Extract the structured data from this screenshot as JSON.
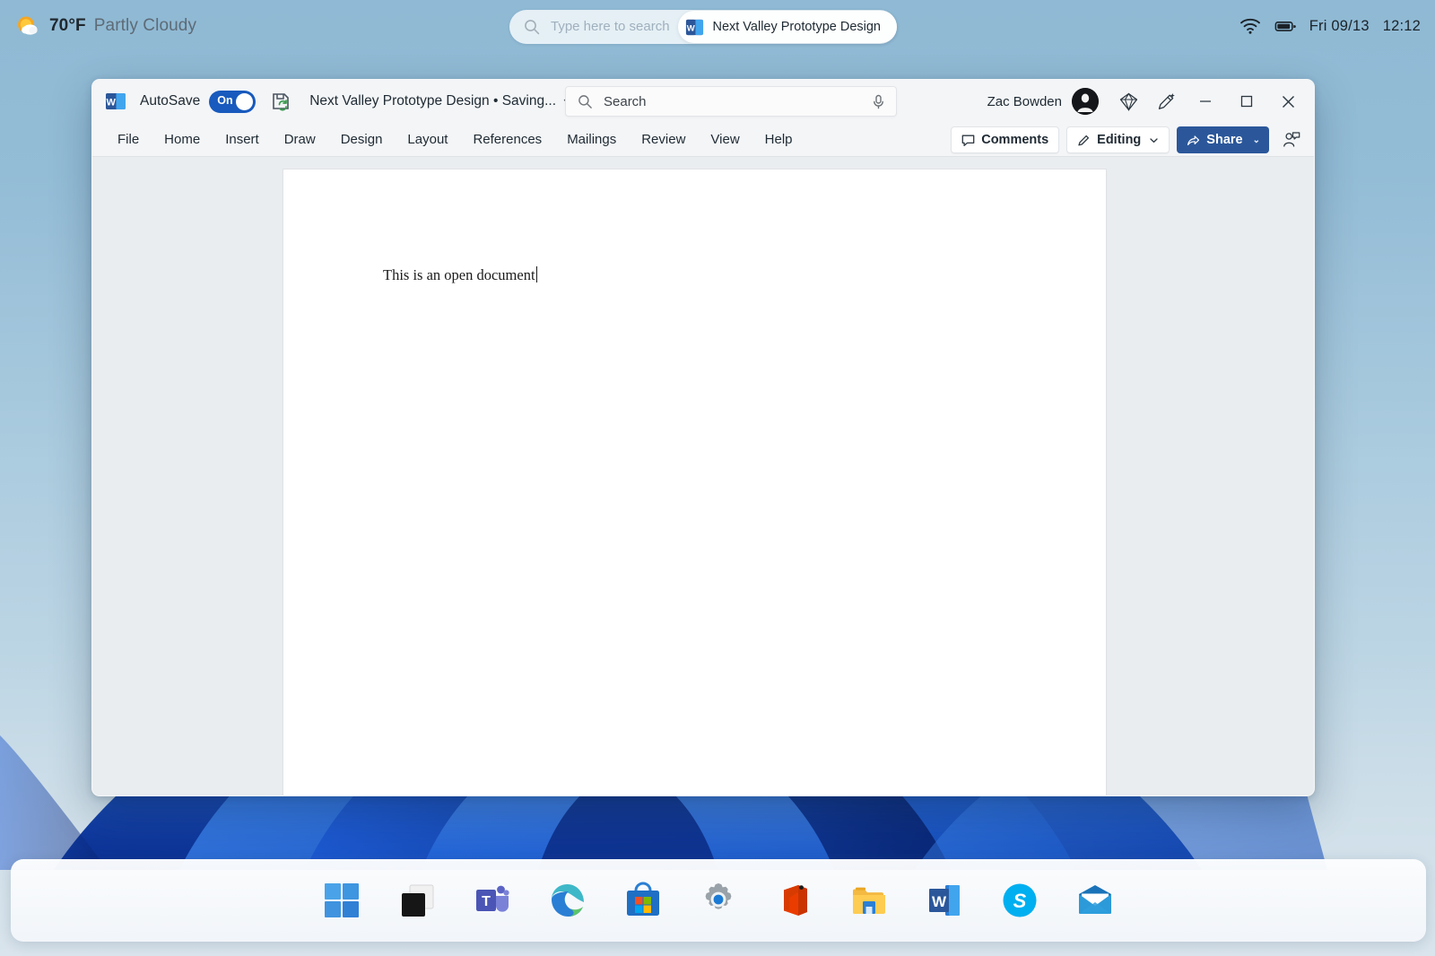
{
  "desktop": {
    "weather": {
      "icon": "partly-cloudy-icon",
      "temperature": "70°F",
      "condition": "Partly Cloudy"
    },
    "taskbar_search": {
      "icon": "search-icon",
      "placeholder": "Type here to search"
    },
    "active_task": {
      "icon": "word-icon",
      "label": "Next Valley Prototype Design"
    },
    "tray": {
      "wifi_icon": "wifi-icon",
      "battery_icon": "battery-icon",
      "date": "Fri 09/13",
      "time": "12:12"
    }
  },
  "word": {
    "titlebar": {
      "app_icon": "word-icon",
      "autosave_label": "AutoSave",
      "autosave_state": "On",
      "save_status_icon": "save-sync-icon",
      "document_title": "Next Valley Prototype Design • Saving...",
      "title_chevron_icon": "chevron-down-icon"
    },
    "search": {
      "icon": "search-icon",
      "value": "Search",
      "mic_icon": "microphone-icon"
    },
    "account": {
      "user_name": "Zac Bowden",
      "avatar_icon": "avatar",
      "diamond_icon": "diamond-icon",
      "editor_icon": "pen-sparkle-icon"
    },
    "window_controls": {
      "minimize_icon": "minimize-icon",
      "maximize_icon": "maximize-icon",
      "close_icon": "close-icon"
    },
    "ribbon_tabs": [
      {
        "label": "File"
      },
      {
        "label": "Home"
      },
      {
        "label": "Insert"
      },
      {
        "label": "Draw"
      },
      {
        "label": "Design"
      },
      {
        "label": "Layout"
      },
      {
        "label": "References"
      },
      {
        "label": "Mailings"
      },
      {
        "label": "Review"
      },
      {
        "label": "View"
      },
      {
        "label": "Help"
      }
    ],
    "ribbon_right": {
      "comments_label": "Comments",
      "comments_icon": "comment-bubble-icon",
      "editing_label": "Editing",
      "editing_icon": "pencil-icon",
      "editing_chevron_icon": "chevron-down-icon",
      "share_label": "Share",
      "share_icon": "share-icon",
      "share_chevron": "⌄",
      "catchup_icon": "person-comment-icon"
    },
    "document": {
      "body_text": "This is an open document"
    }
  },
  "dock": {
    "items": [
      {
        "name": "start-button",
        "icon": "windows-logo-icon"
      },
      {
        "name": "task-view-button",
        "icon": "task-view-icon"
      },
      {
        "name": "teams-app",
        "icon": "teams-icon"
      },
      {
        "name": "edge-app",
        "icon": "edge-icon"
      },
      {
        "name": "microsoft-store-app",
        "icon": "store-icon"
      },
      {
        "name": "settings-app",
        "icon": "gear-icon"
      },
      {
        "name": "office-app",
        "icon": "office-icon"
      },
      {
        "name": "file-explorer-app",
        "icon": "folder-icon"
      },
      {
        "name": "word-app",
        "icon": "word-icon"
      },
      {
        "name": "skype-app",
        "icon": "skype-icon"
      },
      {
        "name": "mail-app",
        "icon": "mail-icon"
      }
    ]
  },
  "colors": {
    "word_blue": "#2b579a",
    "autosave_blue": "#185abd",
    "desktop_blue": "#8fb9d4"
  }
}
